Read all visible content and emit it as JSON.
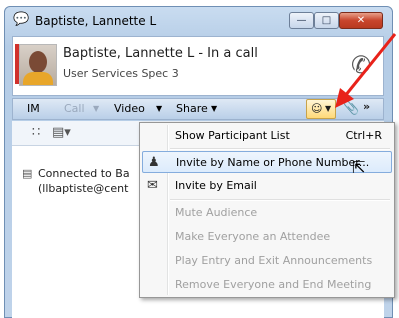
{
  "window": {
    "title": "Baptiste, Lannette L",
    "controls": {
      "minimize": "—",
      "maximize": "□",
      "close": "✕"
    }
  },
  "contact": {
    "name_status": "Baptiste, Lannette L - In a call",
    "title": "User Services Spec 3",
    "presence_color": "#d0312d"
  },
  "tabs": {
    "im": "IM",
    "call": "Call",
    "video": "Video",
    "share": "Share"
  },
  "conversation": {
    "line1": "Connected to Ba",
    "line2": "(llbaptiste@cent"
  },
  "menu": {
    "items": [
      {
        "label": "Show Participant List",
        "shortcut": "Ctrl+R",
        "enabled": true
      },
      {
        "label": "Invite by Name or Phone Number...",
        "enabled": true,
        "highlighted": true,
        "icon": "invite-person-icon"
      },
      {
        "label": "Invite by Email",
        "enabled": true,
        "icon": "email-icon"
      },
      {
        "label": "Mute Audience",
        "enabled": false
      },
      {
        "label": "Make Everyone an Attendee",
        "enabled": false
      },
      {
        "label": "Play Entry and Exit Announcements",
        "enabled": false
      },
      {
        "label": "Remove Everyone and End Meeting",
        "enabled": false
      }
    ]
  },
  "colors": {
    "accent_red": "#e8221a",
    "highlight_border": "#84acdd"
  }
}
